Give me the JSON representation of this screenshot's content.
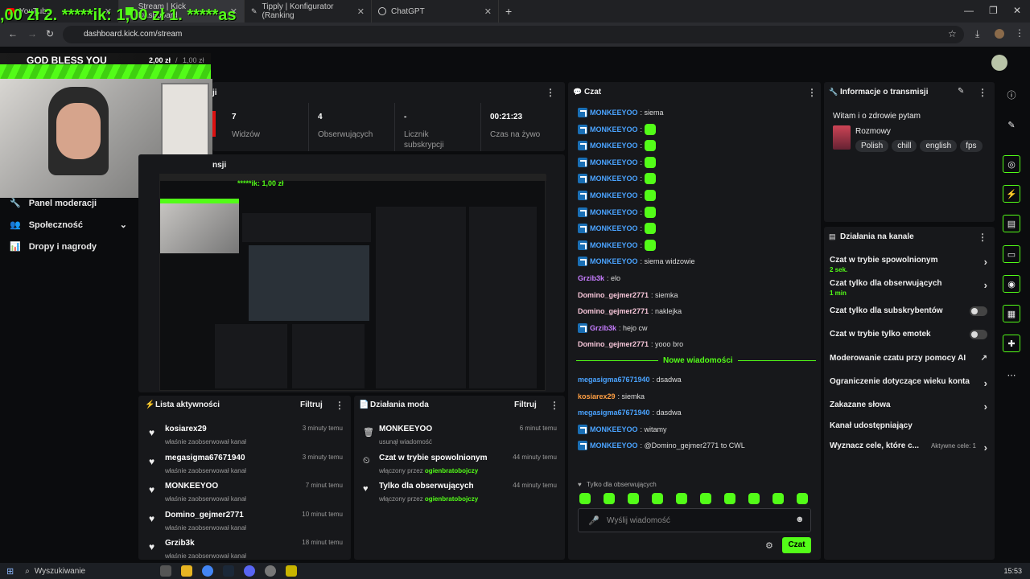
{
  "browser": {
    "tabs": [
      {
        "label": "YouTube",
        "active": false
      },
      {
        "label": "Stream | Kick Dashboard",
        "active": true
      },
      {
        "label": "Tipply | Konfigurator (Ranking",
        "active": false
      },
      {
        "label": "ChatGPT",
        "active": false
      }
    ],
    "url": "dashboard.kick.com/stream"
  },
  "overlay": {
    "ticker": ",00 zł  2. *****ik: 1,00 zł  1. *****as",
    "goal_title": "GOD BLESS YOU",
    "goal_current": "2,00 zł",
    "goal_sep": "/",
    "goal_target": "1,00 zł",
    "inner_ticker": "*****ik: 1,00 zł"
  },
  "sidebar": {
    "items": [
      {
        "label": "Panel moderacji",
        "icon": "wrench-icon"
      },
      {
        "label": "Społeczność",
        "icon": "people-icon"
      },
      {
        "label": "Dropy i nagrody",
        "icon": "chart-icon"
      }
    ]
  },
  "stats_panel": {
    "title_partial": "ji",
    "stats": [
      {
        "value": "7",
        "label": "Widzów"
      },
      {
        "value": "4",
        "label": "Obserwujących"
      },
      {
        "value": "-",
        "label": "Licznik subskrypcji"
      },
      {
        "value": "00:21:23",
        "label": "Czas na żywo"
      }
    ]
  },
  "preview_panel": {
    "title_partial": "nsji"
  },
  "activity": {
    "title": "Lista aktywności",
    "filter": "Filtruj",
    "rows": [
      {
        "name": "kosiarex29",
        "desc": "właśnie zaobserwował kanał",
        "time": "3 minuty temu"
      },
      {
        "name": "megasigma67671940",
        "desc": "właśnie zaobserwował kanał",
        "time": "3 minuty temu"
      },
      {
        "name": "MONKEEYOO",
        "desc": "właśnie zaobserwował kanał",
        "time": "7 minut temu"
      },
      {
        "name": "Domino_gejmer2771",
        "desc": "właśnie zaobserwował kanał",
        "time": "10 minut temu"
      },
      {
        "name": "Grzib3k",
        "desc": "właśnie zaobserwował kanał",
        "time": "18 minut temu"
      }
    ]
  },
  "mod_actions": {
    "title": "Działania moda",
    "filter": "Filtruj",
    "rows": [
      {
        "name": "MONKEEYOO",
        "desc": "usunął wiadomość",
        "by": "",
        "time": "6 minut temu"
      },
      {
        "name": "Czat w trybie spowolnionym",
        "desc": "włączony przez ",
        "by": "ogienbratobojczy",
        "time": "44 minuty temu"
      },
      {
        "name": "Tylko dla obserwujących",
        "desc": "włączony przez ",
        "by": "ogienbratobojczy",
        "time": "44 minuty temu"
      }
    ]
  },
  "chat": {
    "title": "Czat",
    "messages": [
      {
        "user": "MONKEEYOO",
        "text": ": siema",
        "color": "#4aa3ff",
        "badge": true,
        "emote": false
      },
      {
        "user": "MONKEEYOO",
        "text": ":",
        "color": "#4aa3ff",
        "badge": true,
        "emote": true
      },
      {
        "user": "MONKEEYOO",
        "text": ":",
        "color": "#4aa3ff",
        "badge": true,
        "emote": true
      },
      {
        "user": "MONKEEYOO",
        "text": ":",
        "color": "#4aa3ff",
        "badge": true,
        "emote": true
      },
      {
        "user": "MONKEEYOO",
        "text": ":",
        "color": "#4aa3ff",
        "badge": true,
        "emote": true
      },
      {
        "user": "MONKEEYOO",
        "text": ":",
        "color": "#4aa3ff",
        "badge": true,
        "emote": true
      },
      {
        "user": "MONKEEYOO",
        "text": ":",
        "color": "#4aa3ff",
        "badge": true,
        "emote": true
      },
      {
        "user": "MONKEEYOO",
        "text": ":",
        "color": "#4aa3ff",
        "badge": true,
        "emote": true
      },
      {
        "user": "MONKEEYOO",
        "text": ":",
        "color": "#4aa3ff",
        "badge": true,
        "emote": true
      },
      {
        "user": "MONKEEYOO",
        "text": ": siema widzowie",
        "color": "#4aa3ff",
        "badge": true,
        "emote": false
      },
      {
        "user": "Grzib3k",
        "text": ": elo",
        "color": "#c77dff",
        "badge": false,
        "emote": false
      },
      {
        "user": "Domino_gejmer2771",
        "text": ": siemka",
        "color": "#f7c6d9",
        "badge": false,
        "emote": false
      },
      {
        "user": "Domino_gejmer2771",
        "text": ": naklejka",
        "color": "#f7c6d9",
        "badge": false,
        "emote": false
      },
      {
        "user": "Grzib3k",
        "text": ": hejo cw",
        "color": "#c77dff",
        "badge": true,
        "emote": false
      },
      {
        "user": "Domino_gejmer2771",
        "text": ": yooo bro",
        "color": "#f7c6d9",
        "badge": false,
        "emote": false
      }
    ],
    "new_messages_label": "Nowe wiadomości",
    "new_messages": [
      {
        "user": "megasigma67671940",
        "text": ": dsadwa",
        "color": "#4aa3ff",
        "badge": false
      },
      {
        "user": "kosiarex29",
        "text": ": siemka",
        "color": "#ff9f43",
        "badge": false
      },
      {
        "user": "megasigma67671940",
        "text": ": dasdwa",
        "color": "#4aa3ff",
        "badge": false
      },
      {
        "user": "MONKEEYOO",
        "text": ": witamy",
        "color": "#4aa3ff",
        "badge": true
      },
      {
        "user": "MONKEEYOO",
        "text": ": @Domino_gejmer2771 to CWL",
        "color": "#4aa3ff",
        "badge": true
      }
    ],
    "followers_only": "Tylko dla obserwujących",
    "placeholder": "Wyślij wiadomość",
    "send_label": "Czat"
  },
  "stream_info": {
    "title": "Informacje o transmisji",
    "stream_title": "Witam i o zdrowie pytam",
    "category": "Rozmowy",
    "tags": [
      "Polish",
      "chill",
      "english",
      "fps"
    ]
  },
  "channel_actions": {
    "title": "Działania na kanale",
    "rows": [
      {
        "label": "Czat w trybie spowolnionym",
        "sub": "2 sek.",
        "control": "chevron"
      },
      {
        "label": "Czat tylko dla obserwujących",
        "sub": "1 min",
        "control": "chevron"
      },
      {
        "label": "Czat tylko dla subskrybentów",
        "sub": "",
        "control": "toggle"
      },
      {
        "label": "Czat w trybie tylko emotek",
        "sub": "",
        "control": "toggle"
      },
      {
        "label": "Moderowanie czatu przy pomocy AI",
        "sub": "",
        "control": "external"
      },
      {
        "label": "Ograniczenie dotyczące wieku konta",
        "sub": "",
        "control": "chevron"
      },
      {
        "label": "Zakazane słowa",
        "sub": "",
        "control": "chevron"
      },
      {
        "label": "Kanał udostępniający",
        "sub": "",
        "control": "none"
      },
      {
        "label": "Wyznacz cele, które c...",
        "sub": "",
        "control": "chevron",
        "extra": "Aktywne cele: 1"
      }
    ]
  },
  "taskbar": {
    "search": "Wyszukiwanie",
    "time": "15:53"
  },
  "colors": {
    "accent": "#53fc18",
    "panel": "#17181b",
    "bg": "#0b0c0e"
  }
}
